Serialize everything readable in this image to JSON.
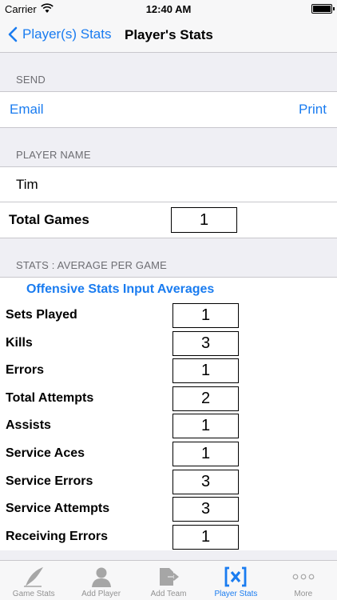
{
  "status_bar": {
    "carrier": "Carrier",
    "time": "12:40 AM"
  },
  "nav": {
    "back_label": "Player(s) Stats",
    "title": "Player's Stats"
  },
  "send": {
    "header": "SEND",
    "email_label": "Email",
    "print_label": "Print"
  },
  "player": {
    "header": "PLAYER NAME",
    "name": "Tim",
    "total_games_label": "Total Games",
    "total_games_value": "1"
  },
  "stats": {
    "header": "STATS : AVERAGE PER GAME",
    "offensive_title": "Offensive Stats Input Averages",
    "rows": [
      {
        "label": "Sets Played",
        "value": "1"
      },
      {
        "label": "Kills",
        "value": "3"
      },
      {
        "label": "Errors",
        "value": "1"
      },
      {
        "label": "Total Attempts",
        "value": "2"
      },
      {
        "label": "Assists",
        "value": "1"
      },
      {
        "label": "Service Aces",
        "value": "1"
      },
      {
        "label": "Service Errors",
        "value": "3"
      },
      {
        "label": "Service Attempts",
        "value": "3"
      },
      {
        "label": "Receiving Errors",
        "value": "1"
      }
    ]
  },
  "tabs": [
    {
      "label": "Game Stats",
      "icon": "quill-icon"
    },
    {
      "label": "Add Player",
      "icon": "person-icon"
    },
    {
      "label": "Add Team",
      "icon": "export-icon"
    },
    {
      "label": "Player Stats",
      "icon": "bracket-x-icon",
      "active": true
    },
    {
      "label": "More",
      "icon": "more-dots-icon"
    }
  ],
  "colors": {
    "accent": "#1a7cf0",
    "inactive_tab": "#929292",
    "group_background": "#efeff4"
  }
}
